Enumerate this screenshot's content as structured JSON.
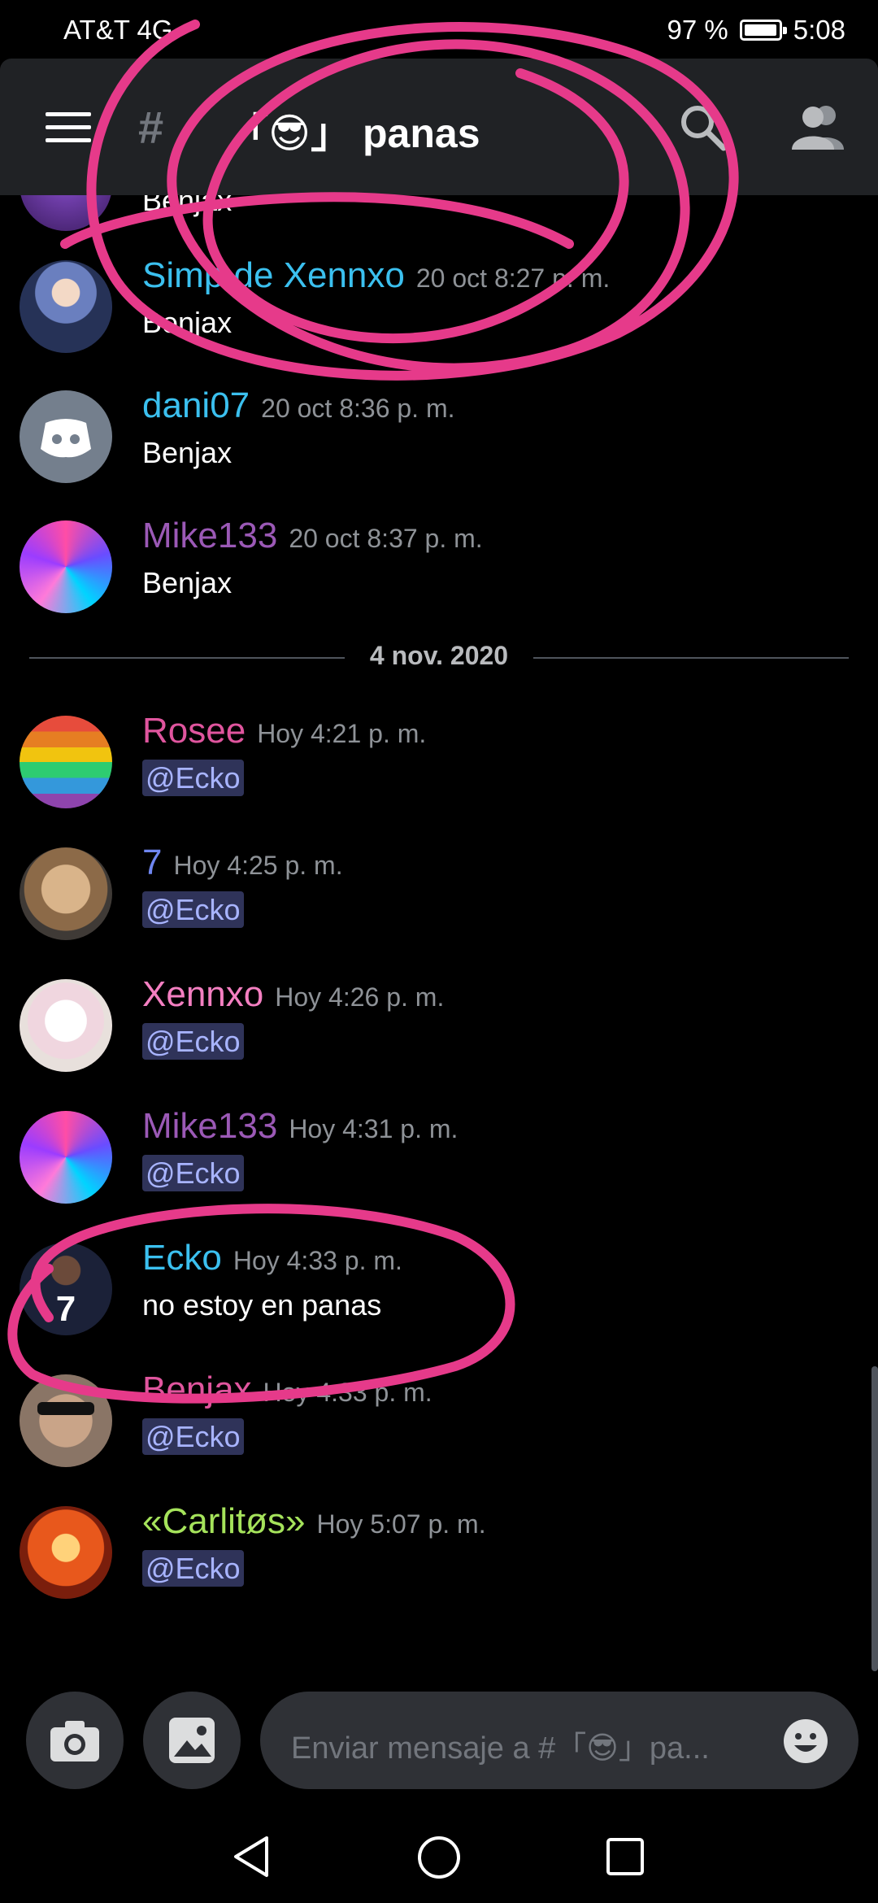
{
  "status_bar": {
    "carrier": "AT&T 4G",
    "battery": "97 %",
    "battery_level": 0.97,
    "time": "5:08"
  },
  "header": {
    "channel_prefix": "#",
    "channel_name": "「😎」 panas",
    "icons": [
      "hamburger-menu-icon",
      "search-icon",
      "members-icon"
    ]
  },
  "messages": [
    {
      "author": "",
      "time": "",
      "text": "Benjax",
      "name_color": "#ffffff",
      "avatar": "partial-avatar"
    },
    {
      "author": "Simp de Xennxo",
      "time": "20 oct 8:27 p. m.",
      "text": "Benjax",
      "name_color": "#3bc0ef",
      "avatar": "anime-girl-avatar"
    },
    {
      "author": "dani07",
      "time": "20 oct 8:36 p. m.",
      "text": "Benjax",
      "name_color": "#3bc0ef",
      "avatar": "discord-default-avatar"
    },
    {
      "author": "Mike133",
      "time": "20 oct 8:37 p. m.",
      "text": "Benjax",
      "name_color": "#9b59b6",
      "avatar": "anime-art-avatar"
    }
  ],
  "date_divider": "4 nov. 2020",
  "messages_today": [
    {
      "author": "Rosee",
      "time": "Hoy 4:21 p. m.",
      "text": "@Ecko",
      "name_color": "#e0559e",
      "avatar": "rainbow-avatar"
    },
    {
      "author": "7",
      "time": "Hoy 4:25 p. m.",
      "text": "@Ecko",
      "name_color": "#6f86f0",
      "avatar": "dog-avatar"
    },
    {
      "author": "Xennxo",
      "time": "Hoy 4:26 p. m.",
      "text": "@Ecko",
      "name_color": "#f47fc1",
      "avatar": "sketch-avatar"
    },
    {
      "author": "Mike133",
      "time": "Hoy 4:31 p. m.",
      "text": "@Ecko",
      "name_color": "#9b59b6",
      "avatar": "anime-art-avatar"
    },
    {
      "author": "Ecko",
      "time": "Hoy 4:33 p. m.",
      "text": "no estoy en panas",
      "name_color": "#3bc0ef",
      "avatar": "football-player-avatar"
    },
    {
      "author": "Benjax",
      "time": "Hoy 4:33 p. m.",
      "text": "@Ecko",
      "name_color": "#e0559e",
      "avatar": "sunglasses-avatar"
    },
    {
      "author": "«Carlitøs»",
      "time": "Hoy 5:07 p. m.",
      "text": "@Ecko",
      "name_color": "#a5e35b",
      "avatar": "anime-fire-avatar"
    }
  ],
  "composer": {
    "placeholder": "Enviar mensaje a #「😎」pa...",
    "icons": [
      "camera-icon",
      "image-icon",
      "emoji-icon"
    ]
  },
  "annotations": {
    "color": "#e63a8a"
  }
}
